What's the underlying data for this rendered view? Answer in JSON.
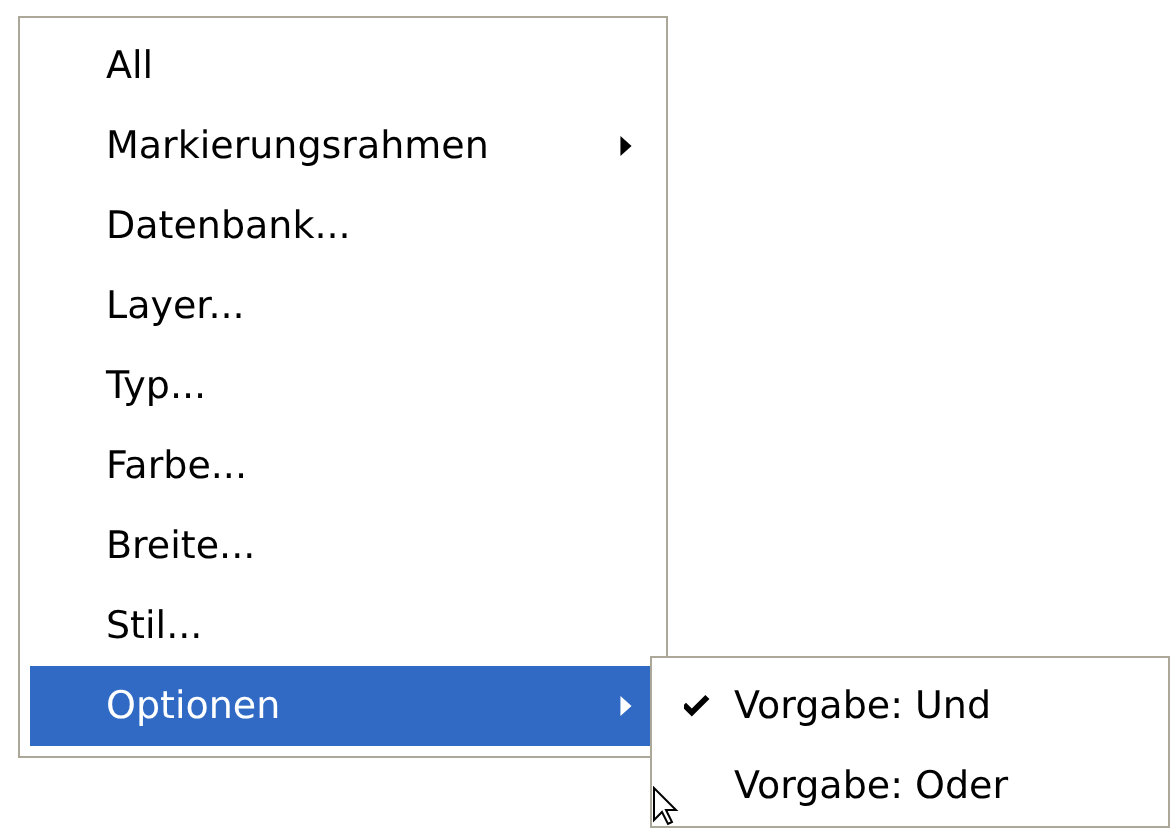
{
  "menu": {
    "items": [
      {
        "label": "All",
        "has_submenu": false,
        "selected": false
      },
      {
        "label": "Markierungsrahmen",
        "has_submenu": true,
        "selected": false
      },
      {
        "label": "Datenbank...",
        "has_submenu": false,
        "selected": false
      },
      {
        "label": "Layer...",
        "has_submenu": false,
        "selected": false
      },
      {
        "label": "Typ...",
        "has_submenu": false,
        "selected": false
      },
      {
        "label": "Farbe...",
        "has_submenu": false,
        "selected": false
      },
      {
        "label": "Breite...",
        "has_submenu": false,
        "selected": false
      },
      {
        "label": "Stil...",
        "has_submenu": false,
        "selected": false
      },
      {
        "label": "Optionen",
        "has_submenu": true,
        "selected": true
      }
    ]
  },
  "submenu": {
    "items": [
      {
        "label": "Vorgabe: Und",
        "checked": true
      },
      {
        "label": "Vorgabe: Oder",
        "checked": false
      }
    ]
  }
}
